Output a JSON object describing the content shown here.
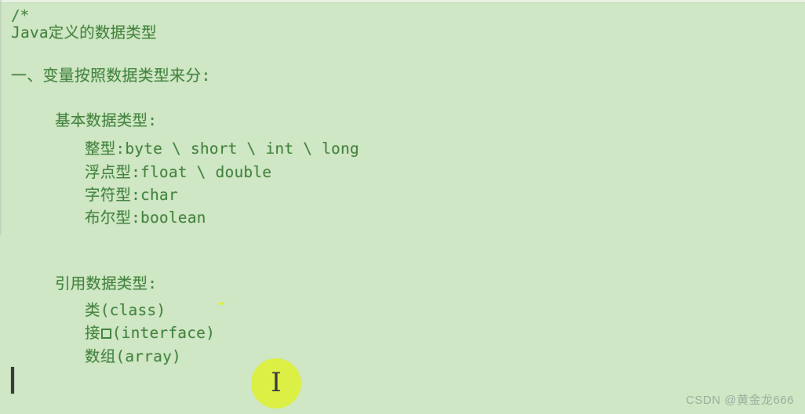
{
  "window": {
    "title": "Java定义的数据类型",
    "background_color": "#cfe7c5",
    "text_color": "#44833f"
  },
  "code": {
    "comment_open": "/*",
    "title": "Java定义的数据类型",
    "section_heading": "一、变量按照数据类型来分:",
    "primitive": {
      "heading": "基本数据类型:",
      "items": [
        "整型:byte \\ short \\ int \\ long",
        "浮点型:float \\ double",
        "字符型:char",
        "布尔型:boolean"
      ]
    },
    "reference": {
      "heading": "引用数据类型:",
      "items_prefix": [
        "类",
        "接",
        "数组"
      ],
      "items": [
        "类(class)",
        "(interface)",
        "数组(array)"
      ]
    }
  },
  "cursor": {
    "pointer_icon": "text-ibeam-cursor",
    "pointer_glyph": "I",
    "highlight_color": "#dcf03a",
    "caret_color": "#3a3a3a"
  },
  "watermark": {
    "text": "CSDN @黄金龙666",
    "color": "#9aa79a"
  }
}
